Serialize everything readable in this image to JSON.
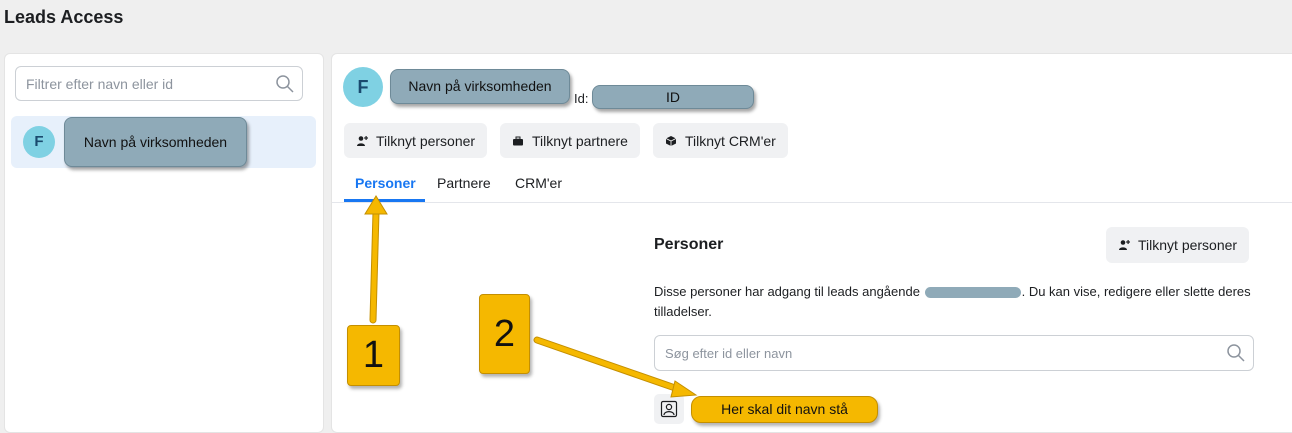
{
  "app": {
    "title": "Leads Access"
  },
  "sidebar": {
    "filter_placeholder": "Filtrer efter navn eller id",
    "items": [
      {
        "avatar_letter": "F",
        "name": "Navn på virksomheden"
      }
    ]
  },
  "company": {
    "avatar_letter": "F",
    "name": "Navn på virksomheden",
    "id_label": "Id:",
    "id_value": "ID"
  },
  "actions": {
    "link_persons": "Tilknyt personer",
    "link_partners": "Tilknyt partnere",
    "link_crms": "Tilknyt CRM'er"
  },
  "tabs": [
    {
      "label": "Personer",
      "active": true
    },
    {
      "label": "Partnere",
      "active": false
    },
    {
      "label": "CRM'er",
      "active": false
    }
  ],
  "persons_section": {
    "title": "Personer",
    "add_button": "Tilknyt personer",
    "description_before": "Disse personer har adgang til leads angående",
    "description_after": ". Du kan vise, redigere eller slette deres tilladelser.",
    "search_placeholder": "Søg efter id eller navn",
    "person_name": "Her skal dit navn stå"
  },
  "annotations": {
    "step1": "1",
    "step2": "2"
  },
  "colors": {
    "accent": "#1877f2",
    "annotation": "#f5b800",
    "redaction": "#8faab8",
    "avatar": "#7fd1e3"
  }
}
